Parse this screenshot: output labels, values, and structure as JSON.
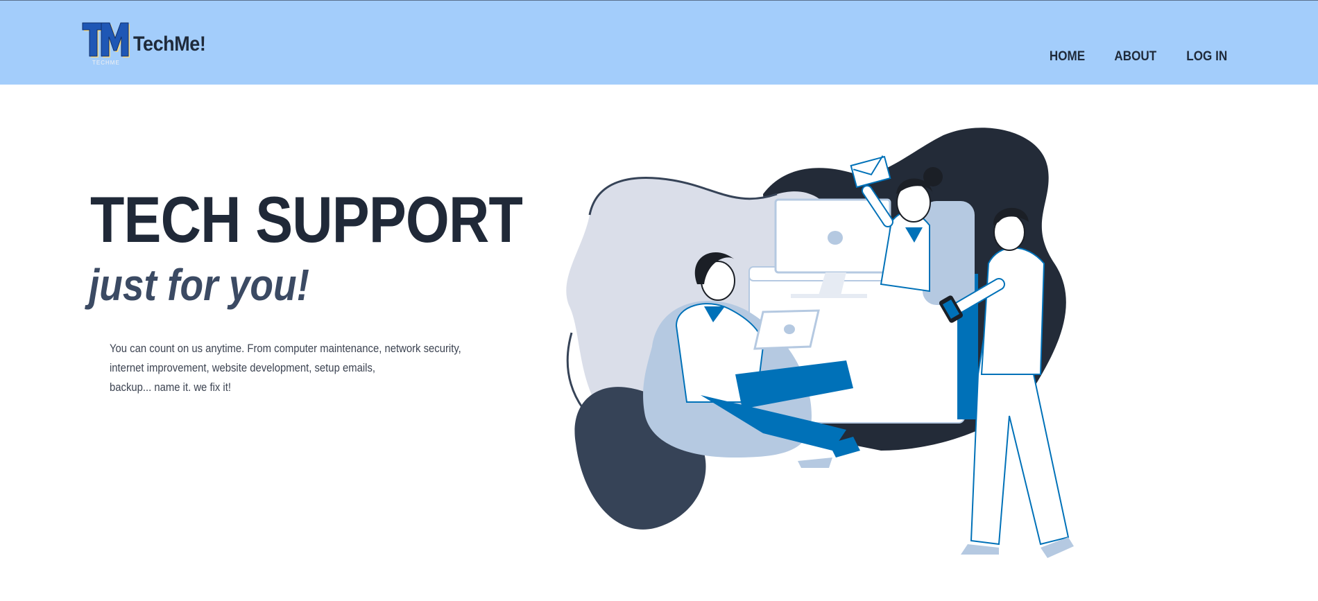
{
  "header": {
    "logo_text": "TechMe!",
    "logo_mark_small": "TECHME",
    "nav": [
      {
        "label": "HOME"
      },
      {
        "label": "ABOUT"
      },
      {
        "label": "LOG IN"
      }
    ],
    "background_color": "#a3cdfb"
  },
  "hero": {
    "title": "TECH SUPPORT",
    "subtitle": "just for you!",
    "description_lines": [
      "You can count on us anytime. From computer maintenance, network security,",
      "internet improvement, website development, setup emails,",
      "backup... name it. we fix it!"
    ]
  },
  "colors": {
    "dark_navy": "#232b38",
    "accent_blue": "#0071b8",
    "light_blue": "#b5c9e1",
    "pale_lavender": "#dadee9",
    "slate": "#364357"
  },
  "illustration": {
    "icons": [
      "envelope-icon",
      "computer-monitor-icon",
      "laptop-icon",
      "smartphone-icon"
    ]
  }
}
